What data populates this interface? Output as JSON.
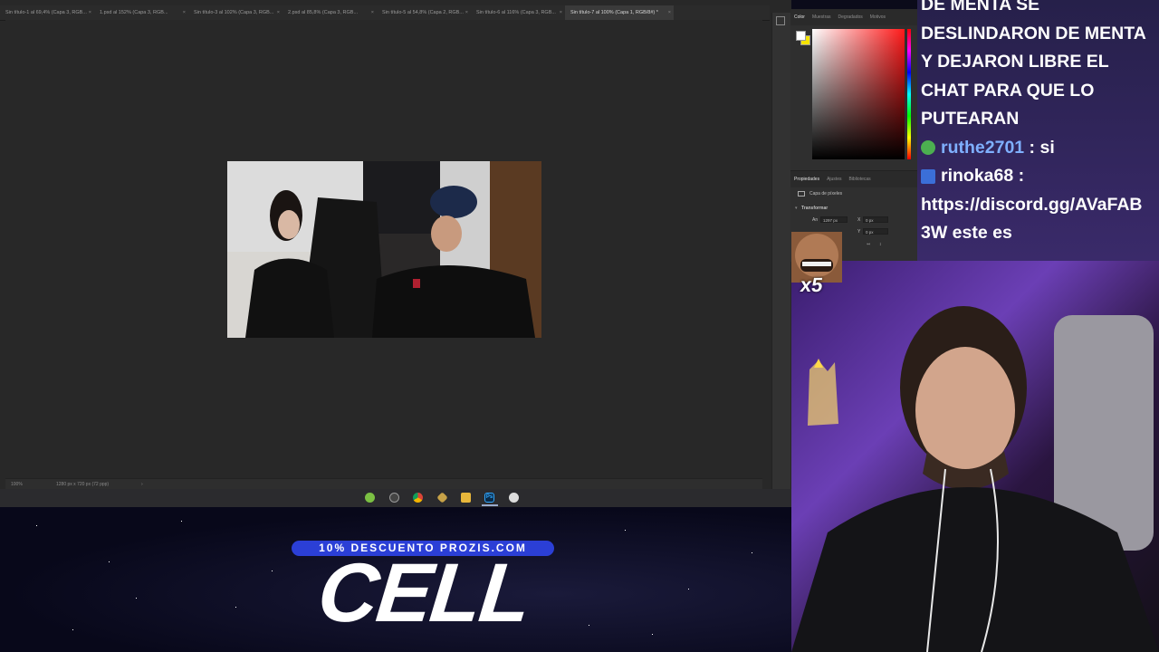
{
  "photoshop": {
    "tabs": [
      "Sin título-1 al 69,4% (Capa 3, RGB...",
      "1.psd al 152% (Capa 3, RGB...",
      "Sin título-3 al 102% (Capa 3, RGB...",
      "2.psd al 85,8% (Capa 3, RGB...",
      "Sin título-5 al 54,8% (Capa 2, RGB...",
      "Sin título-6 al 116% (Capa 3, RGB...",
      "Sin título-7 al 100% (Capa 1, RGB/8#) *"
    ],
    "tab_close": "×",
    "status": {
      "zoom": "100%",
      "doc_size": "1280 px x 720 px (72 ppp)",
      "arrow": "›"
    },
    "color_panel_tabs": [
      "Color",
      "Muestras",
      "Degradados",
      "Motivos"
    ],
    "props_tabs": [
      "Propiedades",
      "Ajustes",
      "Bibliotecas"
    ],
    "layer_kind": "Capa de píxeles",
    "transform_title": "Transformar",
    "transform": {
      "w_label": "An",
      "w_value": "1297 px",
      "x_label": "X",
      "x_value": "0 px",
      "y_label": "Y",
      "y_value": "0 px"
    }
  },
  "promo": {
    "banner": "10% DESCUENTO PROZIS.COM",
    "brand": "CELL"
  },
  "chat": {
    "lines": [
      "DE MENTA SE",
      "DESLINDARON DE MENTA",
      "Y DEJARON LIBRE EL",
      "CHAT PARA QUE LO",
      "PUTEARAN"
    ],
    "messages": [
      {
        "user": "ruthe2701",
        "sep": " : ",
        "text": "si"
      },
      {
        "user": "rinoka68",
        "sep": " :",
        "text": ""
      }
    ],
    "link_lines": [
      "https://discord.gg/AVaFAB",
      "3W este es"
    ]
  },
  "emote": {
    "count": "x5"
  },
  "colors": {
    "ps_bg": "#282828",
    "chat_bg": "#2e245a",
    "promo_blue": "#2b3fd6",
    "username": "#7fb0ff"
  }
}
